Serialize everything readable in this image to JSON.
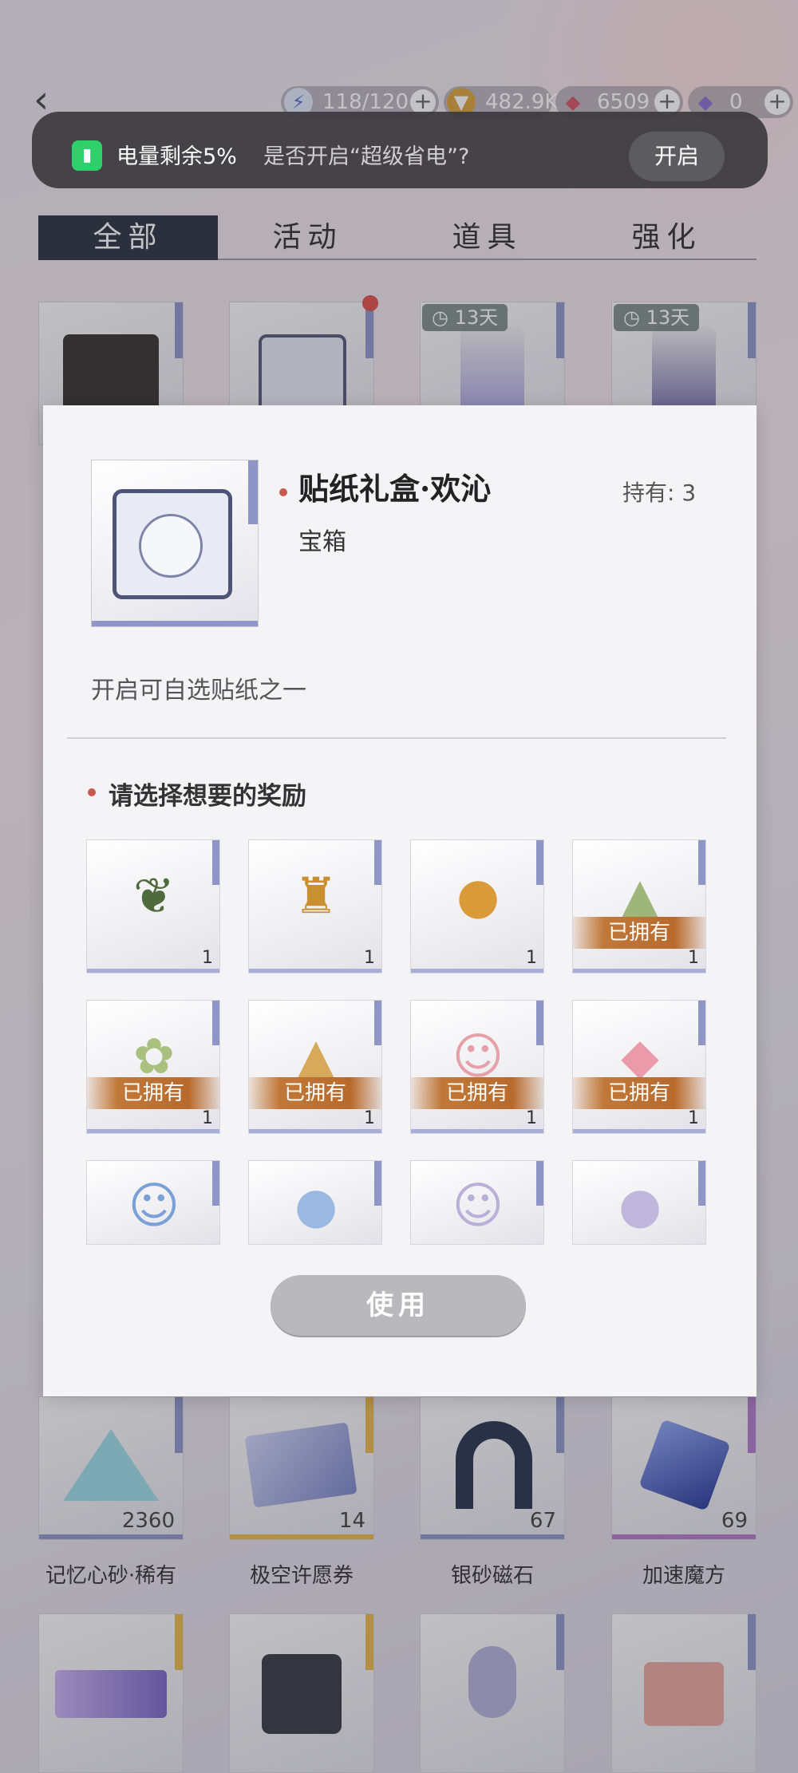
{
  "topbar": {
    "resources": [
      {
        "icon": "stamina-bolt-icon",
        "value": "118/120",
        "color": "#4e74c9"
      },
      {
        "icon": "gold-coin-icon",
        "value": "482.9K",
        "color": "#d9a23c"
      },
      {
        "icon": "red-diamond-icon",
        "value": "6509",
        "color": "#d45466"
      },
      {
        "icon": "purple-diamond-icon",
        "value": "0",
        "color": "#8b6ed0"
      }
    ]
  },
  "banner": {
    "title": "电量剩余5%",
    "question": "是否开启“超级省电”?",
    "button": "开启"
  },
  "tabs": [
    {
      "label": "全部",
      "active": true
    },
    {
      "label": "活动",
      "active": false
    },
    {
      "label": "道具",
      "active": false
    },
    {
      "label": "强化",
      "active": false
    }
  ],
  "top_items": [
    {
      "timer": ""
    },
    {
      "timer": ""
    },
    {
      "timer": "13天"
    },
    {
      "timer": "13天"
    }
  ],
  "bottom_items": [
    {
      "name": "记忆心砂·稀有",
      "count": "2360",
      "accent": "#8e96c8"
    },
    {
      "name": "极空许愿券",
      "count": "14",
      "accent": "#e6b94a"
    },
    {
      "name": "银砂磁石",
      "count": "67",
      "accent": "#8e96c8"
    },
    {
      "name": "加速魔方",
      "count": "69",
      "accent": "#b07cc8"
    }
  ],
  "modal": {
    "title": "贴纸礼盒·欢沁",
    "subtitle": "宝箱",
    "owned": "持有: 3",
    "description": "开启可自选贴纸之一",
    "section_heading": "请选择想要的奖励",
    "owned_label": "已拥有",
    "rewards": [
      {
        "icon": "pine-branch-icon",
        "count": "1",
        "owned": false
      },
      {
        "icon": "lantern-icon",
        "count": "1",
        "owned": false
      },
      {
        "icon": "mooncake-icon",
        "count": "1",
        "owned": false
      },
      {
        "icon": "zongzi-icon",
        "count": "1",
        "owned": true
      },
      {
        "icon": "zongzi-flowers-icon",
        "count": "1",
        "owned": true
      },
      {
        "icon": "zongzi-pair-icon",
        "count": "1",
        "owned": true
      },
      {
        "icon": "chibi-fish-hood-icon",
        "count": "1",
        "owned": true
      },
      {
        "icon": "pink-fish-icon",
        "count": "1",
        "owned": true
      },
      {
        "icon": "chibi-seal-hood-icon",
        "count": "",
        "owned": false
      },
      {
        "icon": "seal-icon",
        "count": "",
        "owned": false
      },
      {
        "icon": "chibi-bunny-hood-icon",
        "count": "",
        "owned": false
      },
      {
        "icon": "bunny-icon",
        "count": "",
        "owned": false
      }
    ],
    "use_button": "使用"
  }
}
